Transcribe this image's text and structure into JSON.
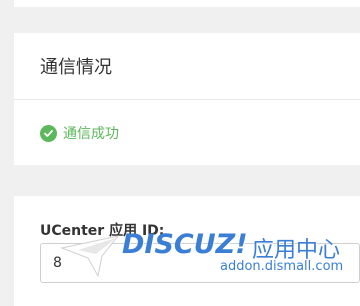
{
  "status_panel": {
    "title": "通信情况",
    "message": "通信成功",
    "status_color": "#5cb85c"
  },
  "form": {
    "app_id_label": "UCenter 应用 ID:",
    "app_id_value": "8"
  },
  "watermark": {
    "brand": "DISCUZ!",
    "suffix": "应用中心",
    "domain": "addon.dismall.com"
  },
  "icons": {
    "status": "check-circle-icon",
    "watermark": "cursor-arrow-icon"
  }
}
